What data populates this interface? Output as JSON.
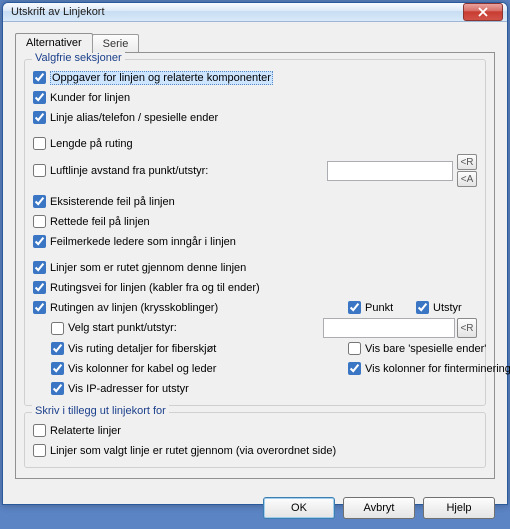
{
  "title": "Utskrift av Linjekort",
  "tabs": {
    "t0": "Alternativer",
    "t1": "Serie"
  },
  "g1": {
    "title": "Valgfrie seksjoner",
    "c0": "Oppgaver for linjen og relaterte komponenter",
    "c1": "Kunder for linjen",
    "c2": "Linje alias/telefon / spesielle ender",
    "c3": "Lengde på ruting",
    "c4": "Luftlinje avstand fra punkt/utstyr:",
    "c5": "Eksisterende feil på linjen",
    "c6": "Rettede feil på linjen",
    "c7": "Feilmerkede ledere som inngår i linjen",
    "c8": "Linjer som er rutet gjennom denne linjen",
    "c9": "Rutingsvei for linjen (kabler fra og til ender)",
    "c10": "Rutingen av linjen (krysskoblinger)",
    "c10a": "Punkt",
    "c10b": "Utstyr",
    "c11": "Velg start punkt/utstyr:",
    "c12": "Vis ruting detaljer for fiberskjøt",
    "c12b": "Vis bare 'spesielle ender'",
    "c13": "Vis kolonner for kabel og leder",
    "c13b": "Vis kolonner for finterminering",
    "c14": "Vis IP-adresser for utstyr",
    "btnR": "<R",
    "btnA": "<A"
  },
  "g2": {
    "title": "Skriv i tillegg ut linjekort for",
    "c0": "Relaterte linjer",
    "c1": "Linjer som valgt linje er rutet gjennom (via overordnet side)"
  },
  "buttons": {
    "ok": "OK",
    "cancel": "Avbryt",
    "help": "Hjelp"
  }
}
